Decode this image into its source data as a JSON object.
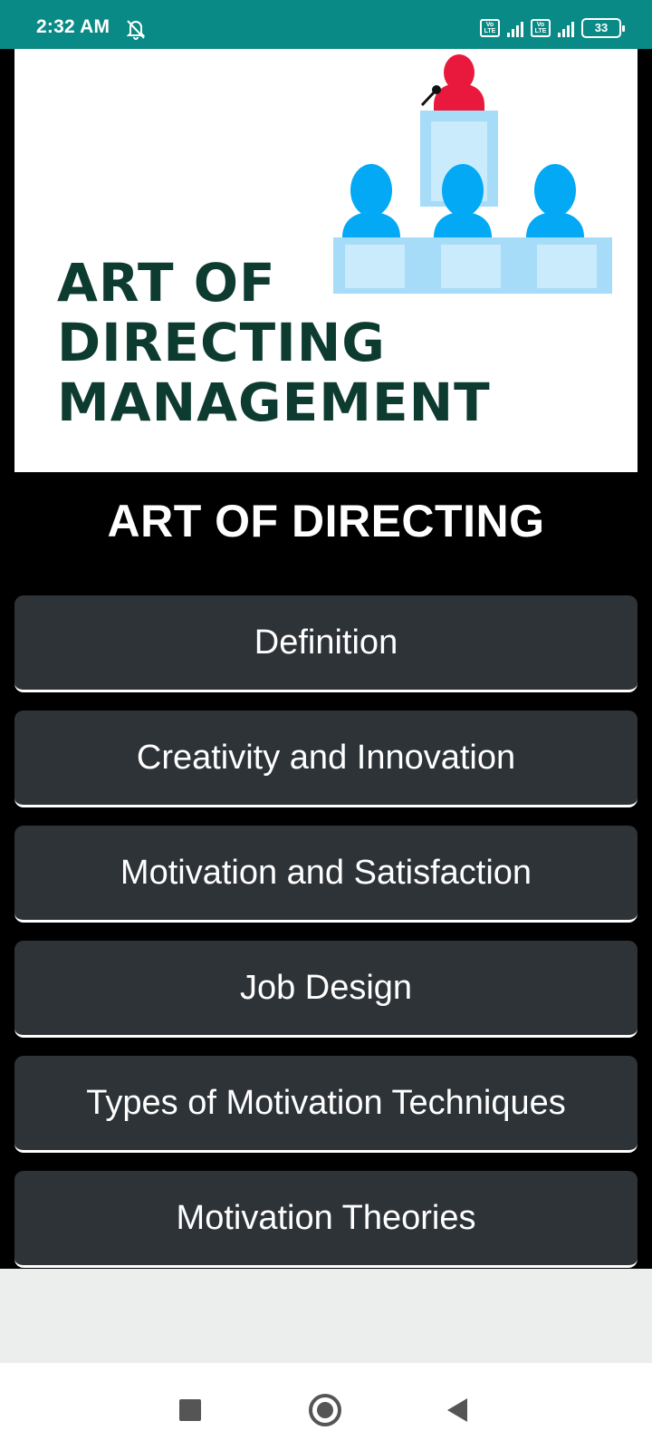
{
  "status_bar": {
    "time": "2:32 AM",
    "sim1_label": "Vo LTE",
    "sim2_label": "Vo LTE",
    "battery": "33"
  },
  "banner": {
    "title_lines": [
      "ART OF",
      "DIRECTING",
      "MANAGEMENT"
    ],
    "colors": {
      "title": "#0d3b30",
      "figure_blue": "#03a9f4",
      "speaker_red": "#e8193c",
      "desk_blue": "#a6dcf7"
    }
  },
  "heading": "ART OF DIRECTING",
  "menu": [
    {
      "label": "Definition"
    },
    {
      "label": "Creativity and Innovation"
    },
    {
      "label": "Motivation and Satisfaction"
    },
    {
      "label": "Job Design"
    },
    {
      "label": "Types of Motivation Techniques"
    },
    {
      "label": "Motivation Theories"
    }
  ],
  "colors": {
    "status_bar": "#0a8a86",
    "button_bg": "#2e3338",
    "background": "#000000"
  },
  "nav": {
    "icons": [
      "recents-square-icon",
      "home-circle-icon",
      "back-triangle-icon"
    ]
  }
}
